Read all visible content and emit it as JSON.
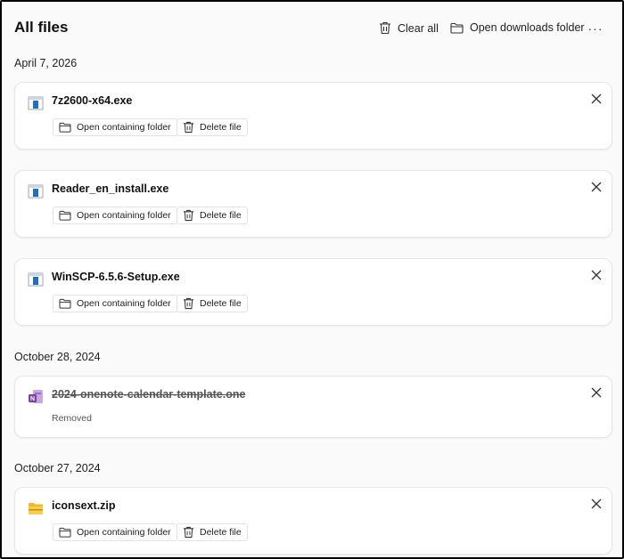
{
  "header": {
    "title": "All files",
    "clear_all": "Clear all",
    "open_downloads": "Open downloads folder",
    "more": "···"
  },
  "actions": {
    "open_folder": "Open containing folder",
    "delete_file": "Delete file"
  },
  "groups": [
    {
      "date": "April 7, 2026",
      "files": [
        {
          "name": "7z2600-x64.exe",
          "icon": "exe-icon"
        },
        {
          "name": "Reader_en_install.exe",
          "icon": "exe-icon"
        },
        {
          "name": "WinSCP-6.5.6-Setup.exe",
          "icon": "exe-icon"
        }
      ]
    },
    {
      "date": "October 28, 2024",
      "files": [
        {
          "name": "2024-onenote-calendar-template.one",
          "icon": "onenote-icon",
          "status": "Removed"
        }
      ]
    },
    {
      "date": "October 27, 2024",
      "files": [
        {
          "name": "iconsext.zip",
          "icon": "zip-folder-icon"
        }
      ]
    }
  ],
  "colors": {
    "exe_blue": "#1f6fc5",
    "onenote_purple": "#7b3fa6",
    "zip_yellow": "#f2b821"
  }
}
